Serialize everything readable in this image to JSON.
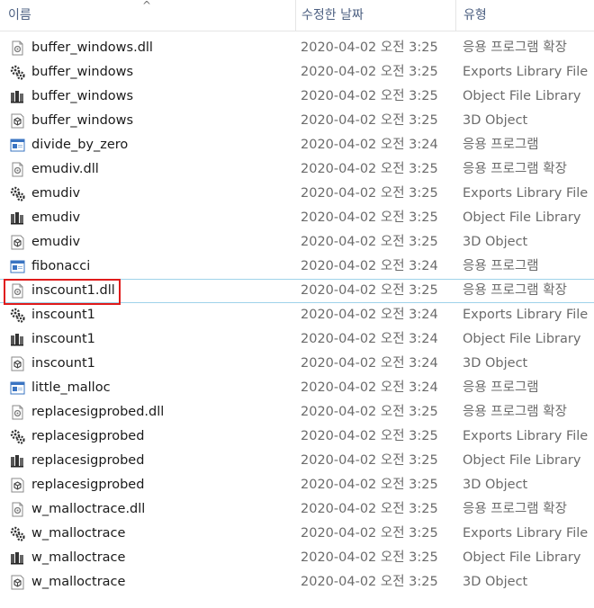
{
  "header": {
    "name_label": "이름",
    "date_label": "수정한 날짜",
    "type_label": "유형",
    "sort_indicator": "^"
  },
  "files": [
    {
      "name": "buffer_windows.dll",
      "date": "2020-04-02 오전 3:25",
      "type": "응용 프로그램 확장",
      "icon": "dll-icon"
    },
    {
      "name": "buffer_windows",
      "date": "2020-04-02 오전 3:25",
      "type": "Exports Library File",
      "icon": "exports-library-icon"
    },
    {
      "name": "buffer_windows",
      "date": "2020-04-02 오전 3:25",
      "type": "Object File Library",
      "icon": "object-library-icon"
    },
    {
      "name": "buffer_windows",
      "date": "2020-04-02 오전 3:25",
      "type": "3D Object",
      "icon": "3d-object-icon"
    },
    {
      "name": "divide_by_zero",
      "date": "2020-04-02 오전 3:24",
      "type": "응용 프로그램",
      "icon": "application-icon"
    },
    {
      "name": "emudiv.dll",
      "date": "2020-04-02 오전 3:25",
      "type": "응용 프로그램 확장",
      "icon": "dll-icon"
    },
    {
      "name": "emudiv",
      "date": "2020-04-02 오전 3:25",
      "type": "Exports Library File",
      "icon": "exports-library-icon"
    },
    {
      "name": "emudiv",
      "date": "2020-04-02 오전 3:25",
      "type": "Object File Library",
      "icon": "object-library-icon"
    },
    {
      "name": "emudiv",
      "date": "2020-04-02 오전 3:25",
      "type": "3D Object",
      "icon": "3d-object-icon"
    },
    {
      "name": "fibonacci",
      "date": "2020-04-02 오전 3:24",
      "type": "응용 프로그램",
      "icon": "application-icon"
    },
    {
      "name": "inscount1.dll",
      "date": "2020-04-02 오전 3:25",
      "type": "응용 프로그램 확장",
      "icon": "dll-icon"
    },
    {
      "name": "inscount1",
      "date": "2020-04-02 오전 3:24",
      "type": "Exports Library File",
      "icon": "exports-library-icon"
    },
    {
      "name": "inscount1",
      "date": "2020-04-02 오전 3:24",
      "type": "Object File Library",
      "icon": "object-library-icon"
    },
    {
      "name": "inscount1",
      "date": "2020-04-02 오전 3:24",
      "type": "3D Object",
      "icon": "3d-object-icon"
    },
    {
      "name": "little_malloc",
      "date": "2020-04-02 오전 3:24",
      "type": "응용 프로그램",
      "icon": "application-icon"
    },
    {
      "name": "replacesigprobed.dll",
      "date": "2020-04-02 오전 3:25",
      "type": "응용 프로그램 확장",
      "icon": "dll-icon"
    },
    {
      "name": "replacesigprobed",
      "date": "2020-04-02 오전 3:25",
      "type": "Exports Library File",
      "icon": "exports-library-icon"
    },
    {
      "name": "replacesigprobed",
      "date": "2020-04-02 오전 3:25",
      "type": "Object File Library",
      "icon": "object-library-icon"
    },
    {
      "name": "replacesigprobed",
      "date": "2020-04-02 오전 3:25",
      "type": "3D Object",
      "icon": "3d-object-icon"
    },
    {
      "name": "w_malloctrace.dll",
      "date": "2020-04-02 오전 3:25",
      "type": "응용 프로그램 확장",
      "icon": "dll-icon"
    },
    {
      "name": "w_malloctrace",
      "date": "2020-04-02 오전 3:25",
      "type": "Exports Library File",
      "icon": "exports-library-icon"
    },
    {
      "name": "w_malloctrace",
      "date": "2020-04-02 오전 3:25",
      "type": "Object File Library",
      "icon": "object-library-icon"
    },
    {
      "name": "w_malloctrace",
      "date": "2020-04-02 오전 3:25",
      "type": "3D Object",
      "icon": "3d-object-icon"
    }
  ],
  "colors": {
    "highlight_border": "#9fd3ea",
    "annotation_box": "#e01b1b",
    "header_text": "#4d6082",
    "secondary_text": "#6b6b6b"
  }
}
